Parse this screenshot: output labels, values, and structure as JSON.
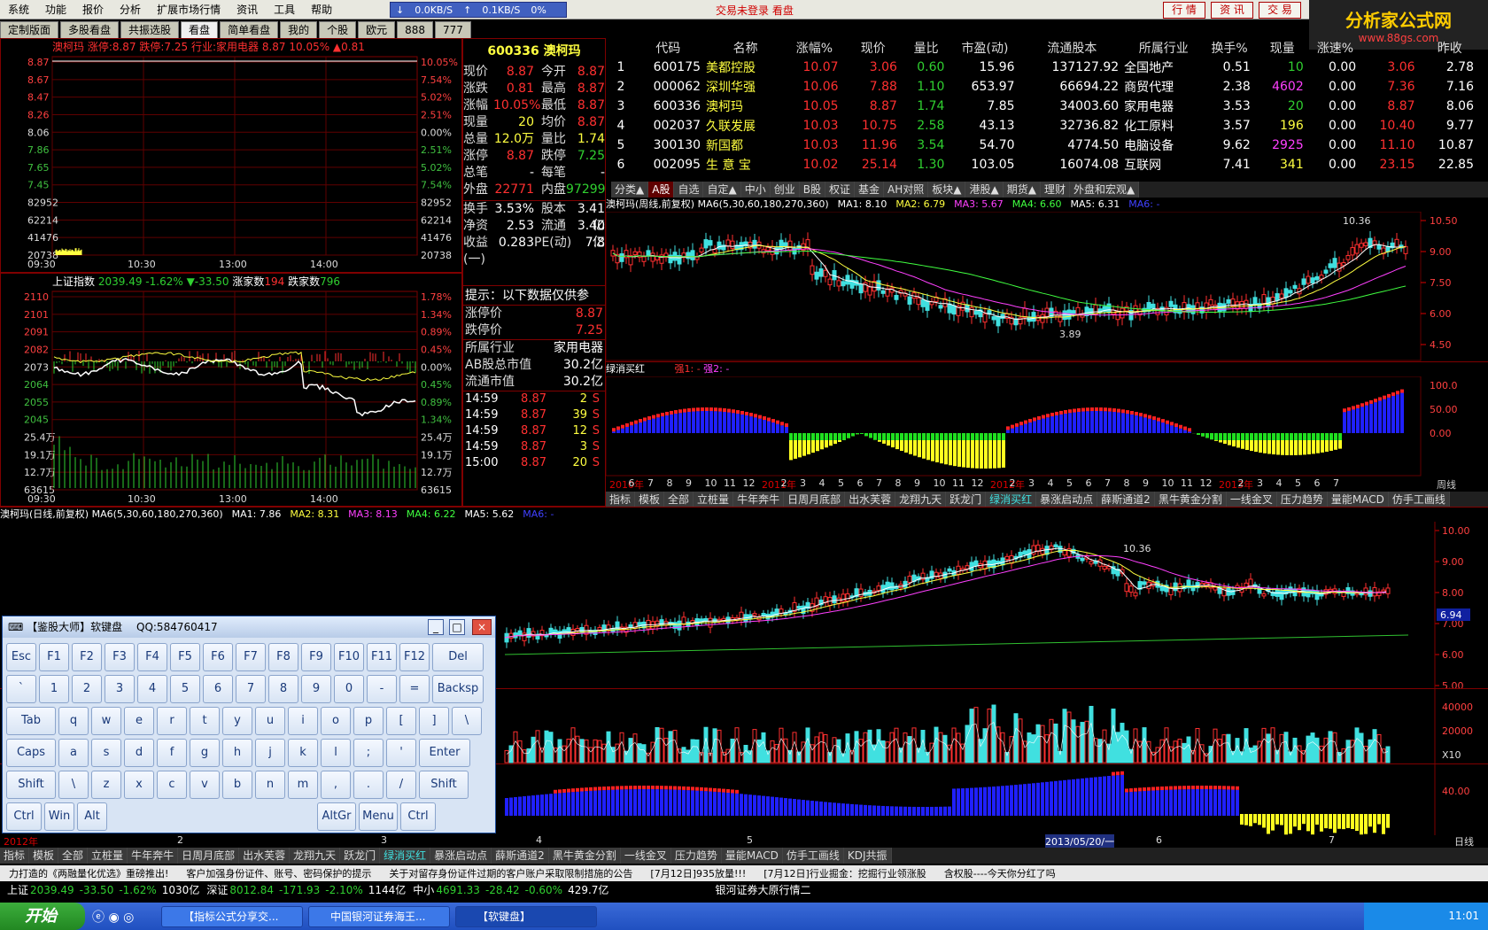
{
  "menu": [
    "系统",
    "功能",
    "报价",
    "分析",
    "扩展市场行情",
    "资讯",
    "工具",
    "帮助"
  ],
  "network": {
    "down": "0.0KB/S",
    "up": "0.1KB/S",
    "pct": "0%"
  },
  "trade_status": "交易未登录  看盘",
  "top_buttons": [
    "行 情",
    "资 讯",
    "交 易"
  ],
  "logo": {
    "name": "分析家公式网",
    "url": "www.88gs.com"
  },
  "tabs": [
    "定制版面",
    "多股看盘",
    "共振选股",
    "看盘",
    "简单看盘",
    "我的",
    "个股",
    "欧元",
    "888",
    "777"
  ],
  "stock_header": {
    "code": "600336",
    "name": "澳柯玛"
  },
  "intraday_header": "澳柯玛  涨停:8.87 跌停:7.25 行业:家用电器 8.87 10.05% ▲0.81",
  "intraday_left_ticks": [
    "8.87",
    "8.67",
    "8.47",
    "8.26",
    "8.06",
    "7.86",
    "7.65",
    "7.45",
    "82952",
    "62214",
    "41476",
    "20738"
  ],
  "intraday_right_ticks": [
    "10.05%",
    "7.54%",
    "5.02%",
    "2.51%",
    "0.00%",
    "2.51%",
    "5.02%",
    "7.54%",
    "82952",
    "62214",
    "41476",
    "20738"
  ],
  "time_ticks": [
    "09:30",
    "10:30",
    "13:00",
    "14:00"
  ],
  "index_header": {
    "name": "上证指数",
    "value": "2039.49",
    "pct": "-1.62%",
    "chg": "▼-33.50",
    "up_label": "涨家数",
    "up": "194",
    "down_label": "跌家数",
    "down": "796"
  },
  "index_left_ticks": [
    "2110",
    "2101",
    "2091",
    "2082",
    "2073",
    "2064",
    "2055",
    "2045",
    "25.4万",
    "19.1万",
    "12.7万",
    "63615"
  ],
  "index_right_ticks": [
    "1.78%",
    "1.34%",
    "0.89%",
    "0.45%",
    "0.00%",
    "0.45%",
    "0.89%",
    "1.34%",
    "25.4万",
    "19.1万",
    "12.7万",
    "63615"
  ],
  "quote_pairs": [
    [
      "现价",
      "8.87",
      "今开",
      "8.87"
    ],
    [
      "涨跌",
      "0.81",
      "最高",
      "8.87"
    ],
    [
      "涨幅",
      "10.05%",
      "最低",
      "8.87"
    ],
    [
      "现量",
      "20",
      "均价",
      "8.87"
    ],
    [
      "总量",
      "12.0万",
      "量比",
      "1.74"
    ],
    [
      "涨停",
      "8.87",
      "跌停",
      "7.25"
    ],
    [
      "总笔",
      "-",
      "每笔",
      "-"
    ],
    [
      "外盘",
      "22771",
      "内盘",
      "97299"
    ]
  ],
  "finance_pairs": [
    [
      "换手",
      "3.53%",
      "股本",
      "3.41亿"
    ],
    [
      "净资",
      "2.53",
      "流通",
      "3.40亿"
    ],
    [
      "收益(一)",
      "0.283",
      "PE(动)",
      "7.8"
    ]
  ],
  "tip": "提示：以下数据仅供参",
  "limits": [
    [
      "涨停价",
      "8.87"
    ],
    [
      "跌停价",
      "7.25"
    ]
  ],
  "industry": [
    [
      "所属行业",
      "家用电器"
    ],
    [
      "AB股总市值",
      "30.2亿"
    ],
    [
      "流通市值",
      "30.2亿"
    ]
  ],
  "ticks": [
    [
      "14:59",
      "8.87",
      "2",
      "S"
    ],
    [
      "14:59",
      "8.87",
      "39",
      "S"
    ],
    [
      "14:59",
      "8.87",
      "12",
      "S"
    ],
    [
      "14:59",
      "8.87",
      "3",
      "S"
    ],
    [
      "15:00",
      "8.87",
      "20",
      "S"
    ]
  ],
  "table_headers": [
    "",
    "代码",
    "名称",
    "涨幅%",
    "现价",
    "量比",
    "市盈(动)",
    "流通股本",
    "所属行业",
    "换手%",
    "现量",
    "涨速%",
    "",
    "昨收"
  ],
  "table_rows": [
    [
      "1",
      "600175",
      "美都控股",
      "10.07",
      "3.06",
      "0.60",
      "15.96",
      "137127.92",
      "全国地产",
      "0.51",
      "10",
      "0.00",
      "3.06",
      "2.78"
    ],
    [
      "2",
      "000062",
      "深圳华强",
      "10.06",
      "7.88",
      "1.10",
      "653.97",
      "66694.22",
      "商贸代理",
      "2.38",
      "4602",
      "0.00",
      "7.36",
      "7.16"
    ],
    [
      "3",
      "600336",
      "澳柯玛",
      "10.05",
      "8.87",
      "1.74",
      "7.85",
      "34003.60",
      "家用电器",
      "3.53",
      "20",
      "0.00",
      "8.87",
      "8.06"
    ],
    [
      "4",
      "002037",
      "久联发展",
      "10.03",
      "10.75",
      "2.58",
      "43.13",
      "32736.82",
      "化工原料",
      "3.57",
      "196",
      "0.00",
      "10.40",
      "9.77"
    ],
    [
      "5",
      "300130",
      "新国都",
      "10.03",
      "11.96",
      "3.54",
      "54.70",
      "4774.50",
      "电脑设备",
      "9.62",
      "2925",
      "0.00",
      "11.10",
      "10.87"
    ],
    [
      "6",
      "002095",
      "生 意 宝",
      "10.02",
      "25.14",
      "1.30",
      "103.05",
      "16074.08",
      "互联网",
      "7.41",
      "341",
      "0.00",
      "23.15",
      "22.85"
    ]
  ],
  "board_tabs": [
    "分类▲",
    "A股",
    "自选",
    "自定▲",
    "中小",
    "创业",
    "B股",
    "权证",
    "基金",
    "AH对照",
    "板块▲",
    "港股▲",
    "期货▲",
    "理财",
    "外盘和宏观▲"
  ],
  "weekly_header": "澳柯玛(周线,前复权) MA6(5,30,60,180,270,360)",
  "weekly_ma": [
    [
      "MA1: 8.10",
      "#ffffff"
    ],
    [
      "MA2: 6.79",
      "#ffff40"
    ],
    [
      "MA3: 5.67",
      "#ff40ff"
    ],
    [
      "MA4: 6.60",
      "#40ff40"
    ],
    [
      "MA5: 6.31",
      "#ffffff"
    ],
    [
      "MA6: -",
      "#4040ff"
    ]
  ],
  "weekly_ticks": [
    "10.50",
    "9.00",
    "7.50",
    "6.00",
    "4.50"
  ],
  "weekly_labels": {
    "high": "10.36",
    "low": "3.89"
  },
  "lvxiao": {
    "name": "绿消买红",
    "s1": "强1: -",
    "s2": "强2: -"
  },
  "lvxiao_ticks": [
    "100.0",
    "50.00",
    "0.00"
  ],
  "weekly_dates": [
    "2010年",
    "6",
    "7",
    "8",
    "9",
    "10",
    "11",
    "12",
    "2011年",
    "2",
    "3",
    "4",
    "5",
    "6",
    "7",
    "8",
    "9",
    "10",
    "11",
    "12",
    "2012年",
    "2",
    "3",
    "4",
    "5",
    "6",
    "7",
    "8",
    "9",
    "10",
    "11",
    "12",
    "2013年",
    "2",
    "3",
    "4",
    "5",
    "6",
    "7"
  ],
  "weekly_period": "周线",
  "indicator_tabs": [
    "指标",
    "模板",
    "全部",
    "立桩量",
    "牛年奔牛",
    "日周月底部",
    "出水芙蓉",
    "龙翔九天",
    "跃龙门",
    "绿消买红",
    "暴涨启动点",
    "薛斯通道2",
    "黑牛黄金分割",
    "一线金叉",
    "压力趋势",
    "量能MACD",
    "仿手工画线"
  ],
  "daily_header": "澳柯玛(日线,前复权) MA6(5,30,60,180,270,360)",
  "daily_ma": [
    [
      "MA1: 7.86",
      "#ffffff"
    ],
    [
      "MA2: 8.31",
      "#ffff40"
    ],
    [
      "MA3: 8.13",
      "#ff40ff"
    ],
    [
      "MA4: 6.22",
      "#40ff40"
    ],
    [
      "MA5: 5.62",
      "#ffffff"
    ],
    [
      "MA6: -",
      "#4040ff"
    ]
  ],
  "daily_ticks": [
    "10.00",
    "9.00",
    "8.00",
    "7.00",
    "6.00",
    "5.00"
  ],
  "daily_price_label": "6.94",
  "daily_high": "10.36",
  "vol_ticks": [
    "40000",
    "20000",
    "X10"
  ],
  "ind_ticks": [
    "40.00"
  ],
  "daily_dates": [
    "2012年",
    "2",
    "3",
    "4",
    "5",
    "2013/05/20/一",
    "6",
    "7"
  ],
  "daily_period": "日线",
  "indicator_tabs2": [
    "指标",
    "模板",
    "全部",
    "立桩量",
    "牛年奔牛",
    "日周月底部",
    "出水芙蓉",
    "龙翔九天",
    "跃龙门",
    "绿消买红",
    "暴涨启动点",
    "薛斯通道2",
    "黑牛黄金分割",
    "一线金叉",
    "压力趋势",
    "量能MACD",
    "仿手工画线",
    "KDJ共振"
  ],
  "keyboard": {
    "title": "【鉴股大师】软键盘",
    "qq": "QQ:584760417",
    "rows": [
      [
        "Esc",
        "F1",
        "F2",
        "F3",
        "F4",
        "F5",
        "F6",
        "F7",
        "F8",
        "F9",
        "F10",
        "F11",
        "F12",
        "Del"
      ],
      [
        "`",
        "1",
        "2",
        "3",
        "4",
        "5",
        "6",
        "7",
        "8",
        "9",
        "0",
        "-",
        "=",
        "Backsp"
      ],
      [
        "Tab",
        "q",
        "w",
        "e",
        "r",
        "t",
        "y",
        "u",
        "i",
        "o",
        "p",
        "[",
        "]",
        "\\"
      ],
      [
        "Caps",
        "a",
        "s",
        "d",
        "f",
        "g",
        "h",
        "j",
        "k",
        "l",
        ";",
        "'",
        "Enter"
      ],
      [
        "Shift",
        "\\",
        "z",
        "x",
        "c",
        "v",
        "b",
        "n",
        "m",
        ",",
        ".",
        "/",
        "Shift"
      ],
      [
        "Ctrl",
        "Win",
        "Alt",
        "AltGr",
        "Menu",
        "Ctrl"
      ]
    ]
  },
  "news": [
    "力打造的《两融量化优选》重磅推出!",
    "客户加强身份证件、账号、密码保护的提示",
    "关于对留存身份证件过期的客户账户采取限制措施的公告",
    "[7月12日]935放量!!!",
    "[7月12日]行业掘金：挖掘行业领涨股",
    "含权股----今天你分红了吗"
  ],
  "indexbar": [
    {
      "name": "上证",
      "v": "2039.49",
      "c": "-33.50",
      "p": "-1.62%",
      "a": "1030亿"
    },
    {
      "name": "深证",
      "v": "8012.84",
      "c": "-171.93",
      "p": "-2.10%",
      "a": "1144亿"
    },
    {
      "name": "中小",
      "v": "4691.33",
      "c": "-28.42",
      "p": "-0.60%",
      "a": "429.7亿"
    }
  ],
  "broker": "银河证券大原行情二",
  "taskbar": {
    "start": "开始",
    "tasks": [
      "【指标公式分享交...",
      "中国银河证券海王...",
      "【软键盘】"
    ],
    "clock": "11:01"
  },
  "colors": {
    "up": "#ff3030",
    "down": "#40e0e0",
    "grid": "#800000",
    "bg": "#000000"
  }
}
